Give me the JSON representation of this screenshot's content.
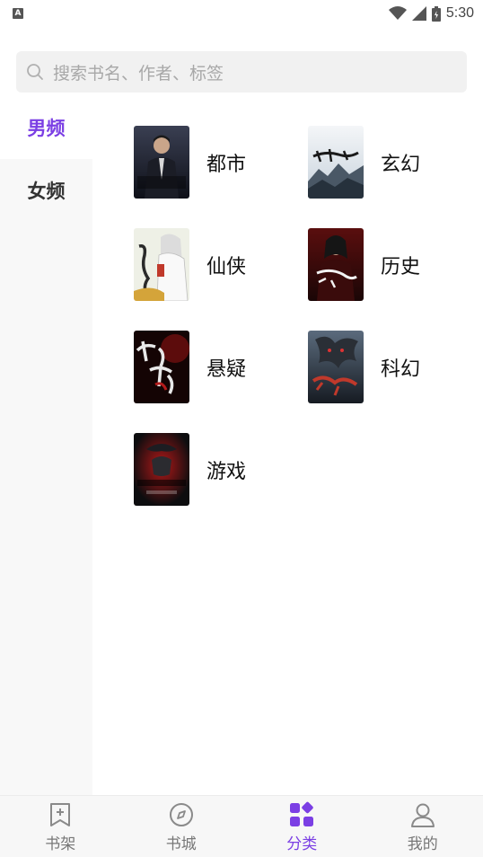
{
  "status_bar": {
    "notification_letter": "A",
    "time": "5:30"
  },
  "search": {
    "placeholder": "搜索书名、作者、标签"
  },
  "side_nav": {
    "items": [
      {
        "label": "男频",
        "active": true
      },
      {
        "label": "女频",
        "active": false
      }
    ]
  },
  "categories": [
    {
      "label": "都市",
      "cover_title": "全尊神婿",
      "cover_icon": "dark-suit-man-cover"
    },
    {
      "label": "玄幻",
      "cover_title": "万古枭婿",
      "cover_icon": "misty-mountain-cover"
    },
    {
      "label": "仙侠",
      "cover_title": "极品仙尊",
      "cover_icon": "white-robed-immortal-cover"
    },
    {
      "label": "历史",
      "cover_title": "万婿",
      "cover_icon": "red-warrior-cover"
    },
    {
      "label": "悬疑",
      "cover_title": "九元石棺",
      "cover_icon": "red-calligraphy-cover"
    },
    {
      "label": "科幻",
      "cover_title": "养龙啊",
      "cover_icon": "dragon-cover"
    },
    {
      "label": "游戏",
      "cover_title": "网游之万人之上",
      "cover_icon": "red-glow-figure-cover"
    }
  ],
  "bottom_nav": {
    "tabs": [
      {
        "label": "书架",
        "icon": "bookmark-icon",
        "active": false
      },
      {
        "label": "书城",
        "icon": "compass-icon",
        "active": false
      },
      {
        "label": "分类",
        "icon": "category-grid-icon",
        "active": true
      },
      {
        "label": "我的",
        "icon": "user-icon",
        "active": false
      }
    ]
  },
  "colors": {
    "accent": "#7b3fe4",
    "side_nav_bg": "#f8f8f8",
    "search_bg": "#f1f1f1",
    "bottom_nav_bg": "#f7f7f7"
  }
}
